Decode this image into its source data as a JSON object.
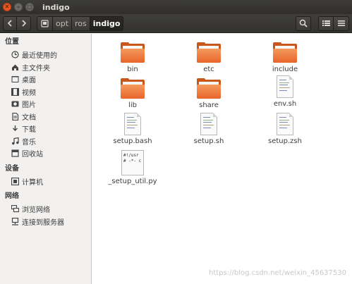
{
  "window": {
    "title": "indigo",
    "buttons": [
      "close",
      "minimize",
      "maximize"
    ]
  },
  "toolbar": {
    "back_icon": "back-arrow-icon",
    "forward_icon": "forward-arrow-icon",
    "breadcrumbs": [
      "opt",
      "ros",
      "indigo"
    ],
    "active_crumb": "indigo",
    "search_icon": "search-icon",
    "view_icon": "list-view-icon",
    "menu_icon": "menu-icon"
  },
  "sidebar": {
    "sections": [
      {
        "title": "位置",
        "items": [
          {
            "label": "最近使用的",
            "icon": "recent-icon"
          },
          {
            "label": "主文件夹",
            "icon": "home-icon"
          },
          {
            "label": "桌面",
            "icon": "desktop-icon"
          },
          {
            "label": "视频",
            "icon": "video-icon"
          },
          {
            "label": "图片",
            "icon": "picture-icon"
          },
          {
            "label": "文档",
            "icon": "document-icon"
          },
          {
            "label": "下载",
            "icon": "download-icon"
          },
          {
            "label": "音乐",
            "icon": "music-icon"
          },
          {
            "label": "回收站",
            "icon": "trash-icon"
          }
        ]
      },
      {
        "title": "设备",
        "items": [
          {
            "label": "计算机",
            "icon": "computer-icon"
          }
        ]
      },
      {
        "title": "网络",
        "items": [
          {
            "label": "浏览网络",
            "icon": "network-icon"
          },
          {
            "label": "连接到服务器",
            "icon": "server-icon"
          }
        ]
      }
    ]
  },
  "files": [
    {
      "name": "bin",
      "type": "folder"
    },
    {
      "name": "etc",
      "type": "folder"
    },
    {
      "name": "include",
      "type": "folder"
    },
    {
      "name": "lib",
      "type": "folder"
    },
    {
      "name": "share",
      "type": "folder"
    },
    {
      "name": "env.sh",
      "type": "script"
    },
    {
      "name": "setup.bash",
      "type": "script"
    },
    {
      "name": "setup.sh",
      "type": "script"
    },
    {
      "name": "setup.zsh",
      "type": "script"
    },
    {
      "name": "_setup_util.py",
      "type": "python",
      "preview": "#!/usr\n# -*- c"
    }
  ],
  "watermark": "https://blog.csdn.net/weixin_45637530",
  "colors": {
    "accent": "#e95420",
    "folder": "#e8652b",
    "titlebar": "#3d3c38"
  }
}
